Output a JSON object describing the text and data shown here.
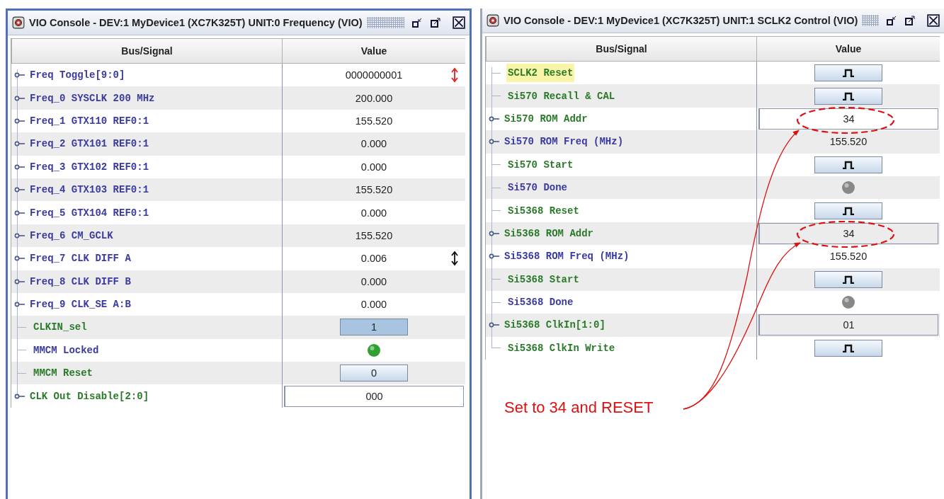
{
  "windows": [
    {
      "title": "VIO Console - DEV:1 MyDevice1 (XC7K325T) UNIT:0 Frequency (VIO)",
      "columns": [
        "Bus/Signal",
        "Value"
      ],
      "rows": [
        {
          "name": "Freq Toggle[9:0]",
          "output": false,
          "bus": true,
          "selected": false,
          "kind": "text",
          "value": "0000000001",
          "arrow": true,
          "recent": true
        },
        {
          "name": "Freq_0 SYSCLK 200 MHz",
          "output": false,
          "bus": true,
          "selected": false,
          "kind": "text",
          "value": "200.000",
          "arrow": false
        },
        {
          "name": "Freq_1 GTX110 REF0:1",
          "output": false,
          "bus": true,
          "selected": false,
          "kind": "text",
          "value": "155.520",
          "arrow": false
        },
        {
          "name": "Freq_2 GTX101 REF0:1",
          "output": false,
          "bus": true,
          "selected": false,
          "kind": "text",
          "value": "0.000",
          "arrow": false
        },
        {
          "name": "Freq_3 GTX102 REF0:1",
          "output": false,
          "bus": true,
          "selected": false,
          "kind": "text",
          "value": "0.000",
          "arrow": false
        },
        {
          "name": "Freq_4 GTX103 REF0:1",
          "output": false,
          "bus": true,
          "selected": false,
          "kind": "text",
          "value": "155.520",
          "arrow": false
        },
        {
          "name": "Freq_5 GTX104 REF0:1",
          "output": false,
          "bus": true,
          "selected": false,
          "kind": "text",
          "value": "0.000",
          "arrow": false
        },
        {
          "name": "Freq_6 CM_GCLK",
          "output": false,
          "bus": true,
          "selected": false,
          "kind": "text",
          "value": "155.520",
          "arrow": false
        },
        {
          "name": "Freq_7 CLK DIFF A",
          "output": false,
          "bus": true,
          "selected": false,
          "kind": "text",
          "value": "0.006",
          "arrow": true,
          "recent": false
        },
        {
          "name": "Freq_8 CLK DIFF B",
          "output": false,
          "bus": true,
          "selected": false,
          "kind": "text",
          "value": "0.000",
          "arrow": false
        },
        {
          "name": "Freq_9 CLK_SE A:B",
          "output": false,
          "bus": true,
          "selected": false,
          "kind": "text",
          "value": "0.000",
          "arrow": false
        },
        {
          "name": "CLKIN_sel",
          "output": true,
          "bus": false,
          "selected": false,
          "kind": "button",
          "value": "1",
          "pressed": true
        },
        {
          "name": "MMCM Locked",
          "output": false,
          "bus": false,
          "selected": false,
          "kind": "led",
          "on": true
        },
        {
          "name": "MMCM Reset",
          "output": true,
          "bus": false,
          "selected": false,
          "kind": "button",
          "value": "0",
          "pressed": false
        },
        {
          "name": "CLK Out Disable[2:0]",
          "output": true,
          "bus": true,
          "selected": false,
          "kind": "field",
          "value": "000"
        }
      ]
    },
    {
      "title": "VIO Console - DEV:1 MyDevice1 (XC7K325T) UNIT:1  SCLK2 Control (VIO)",
      "columns": [
        "Bus/Signal",
        "Value"
      ],
      "rows": [
        {
          "name": "SCLK2 Reset",
          "output": true,
          "bus": false,
          "selected": true,
          "kind": "pulse"
        },
        {
          "name": "Si570 Recall & CAL",
          "output": true,
          "bus": false,
          "selected": false,
          "kind": "pulse"
        },
        {
          "name": "Si570 ROM Addr",
          "output": true,
          "bus": true,
          "selected": false,
          "kind": "field",
          "value": "34"
        },
        {
          "name": "Si570 ROM Freq (MHz)",
          "output": false,
          "bus": true,
          "selected": false,
          "kind": "text",
          "value": "155.520"
        },
        {
          "name": "Si570 Start",
          "output": true,
          "bus": false,
          "selected": false,
          "kind": "pulse"
        },
        {
          "name": "Si570 Done",
          "output": false,
          "bus": false,
          "selected": false,
          "kind": "led",
          "on": false
        },
        {
          "name": "Si5368 Reset",
          "output": true,
          "bus": false,
          "selected": false,
          "kind": "pulse"
        },
        {
          "name": "Si5368 ROM Addr",
          "output": true,
          "bus": true,
          "selected": false,
          "kind": "field",
          "value": "34"
        },
        {
          "name": "Si5368 ROM Freq (MHz)",
          "output": false,
          "bus": true,
          "selected": false,
          "kind": "text",
          "value": "155.520"
        },
        {
          "name": "Si5368 Start",
          "output": true,
          "bus": false,
          "selected": false,
          "kind": "pulse"
        },
        {
          "name": "Si5368 Done",
          "output": false,
          "bus": false,
          "selected": false,
          "kind": "led",
          "on": false
        },
        {
          "name": "Si5368 ClkIn[1:0]",
          "output": true,
          "bus": true,
          "selected": false,
          "kind": "field",
          "value": "01"
        },
        {
          "name": "Si5368 ClkIn Write",
          "output": true,
          "bus": false,
          "selected": false,
          "kind": "pulse"
        }
      ]
    }
  ],
  "annotation": {
    "text": "Set to 34 and RESET"
  }
}
